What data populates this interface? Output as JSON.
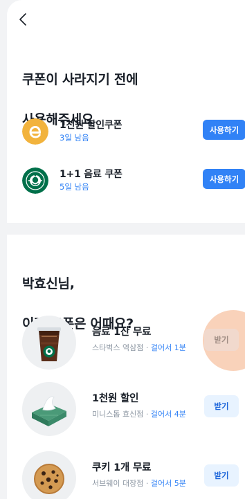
{
  "header": {
    "back_icon": "chevron-left-icon"
  },
  "expiring": {
    "title_line1": "쿠폰이 사라지기 전에",
    "title_line2": "사용해주세요",
    "items": [
      {
        "name": "1천원 할인쿠폰",
        "remaining": "3일 남음",
        "logo": "e-logo",
        "logo_color": "#f2b33d",
        "action": "사용하기"
      },
      {
        "name": "1+1 음료 쿠폰",
        "remaining": "5일 남음",
        "logo": "starbucks-logo",
        "logo_color": "#00704a",
        "action": "사용하기"
      }
    ]
  },
  "recommend": {
    "title_line1": "박효신님,",
    "title_line2": "이런 쿠폰은 어때요?",
    "items": [
      {
        "title": "음료 1잔 무료",
        "store": "스타벅스 역삼점",
        "separator": " · ",
        "distance": "걸어서 1분",
        "image": "iced-coffee-icon",
        "action": "받기",
        "pressed": true
      },
      {
        "title": "1천원 할인",
        "store": "미니스톱 효신점",
        "separator": " · ",
        "distance": "걸어서 4분",
        "image": "tissue-box-icon",
        "action": "받기",
        "pressed": false
      },
      {
        "title": "쿠키 1개 무료",
        "store": "서브웨이 대장점",
        "separator": " · ",
        "distance": "걸어서 5분",
        "image": "cookie-icon",
        "action": "받기",
        "pressed": false
      }
    ]
  },
  "colors": {
    "accent": "#3182f6",
    "accent_soft": "#e8f3ff",
    "background": "#f2f3f5",
    "pressed_ripple": "#f8cdb3"
  }
}
